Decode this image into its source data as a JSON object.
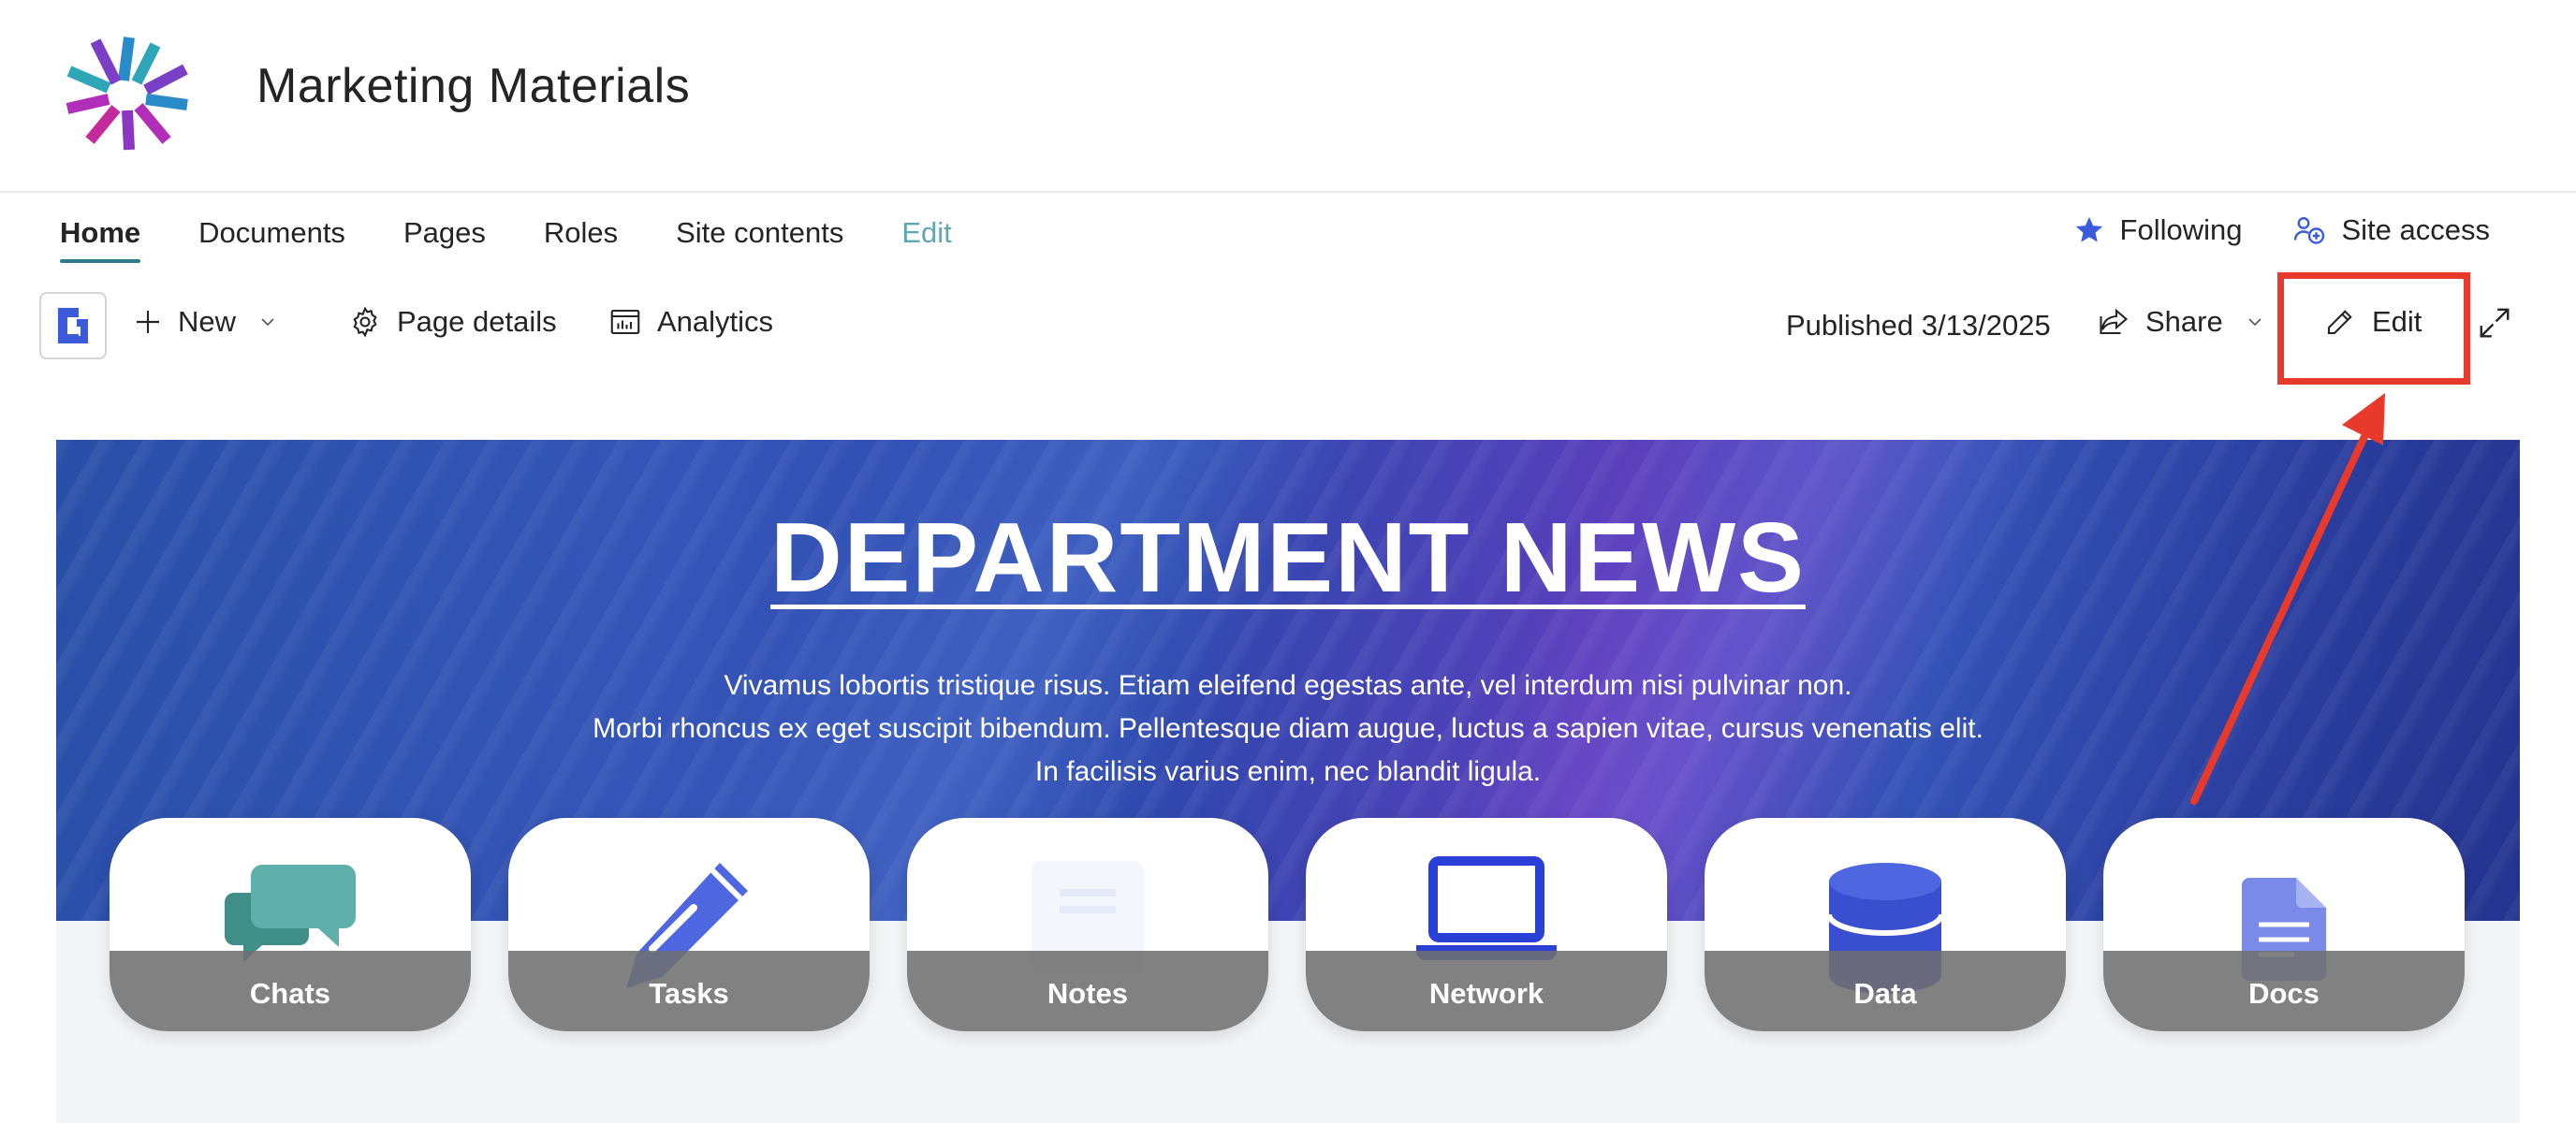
{
  "site": {
    "title": "Marketing Materials"
  },
  "nav": {
    "items": [
      {
        "label": "Home"
      },
      {
        "label": "Documents"
      },
      {
        "label": "Pages"
      },
      {
        "label": "Roles"
      },
      {
        "label": "Site contents"
      },
      {
        "label": "Edit"
      }
    ],
    "following_label": "Following",
    "site_access_label": "Site access"
  },
  "commandbar": {
    "new_label": "New",
    "page_details_label": "Page details",
    "analytics_label": "Analytics",
    "published_text": "Published 3/13/2025",
    "share_label": "Share",
    "edit_label": "Edit"
  },
  "banner": {
    "title": "DEPARTMENT NEWS",
    "lines": [
      "Vivamus lobortis tristique risus. Etiam eleifend egestas ante, vel interdum nisi pulvinar non.",
      "Morbi rhoncus ex eget suscipit bibendum. Pellentesque diam augue, luctus a sapien vitae, cursus venenatis elit.",
      "In facilisis varius enim, nec blandit ligula."
    ]
  },
  "tiles": [
    {
      "label": "Chats",
      "icon": "chat-bubbles-icon"
    },
    {
      "label": "Tasks",
      "icon": "pencil-icon"
    },
    {
      "label": "Notes",
      "icon": "notes-icon"
    },
    {
      "label": "Network",
      "icon": "laptop-icon"
    },
    {
      "label": "Data",
      "icon": "database-icon"
    },
    {
      "label": "Docs",
      "icon": "document-icon"
    }
  ],
  "colors": {
    "accent_nav": "#2c7a8a",
    "highlight": "#e8392d",
    "following_star": "#3b5bdb"
  }
}
